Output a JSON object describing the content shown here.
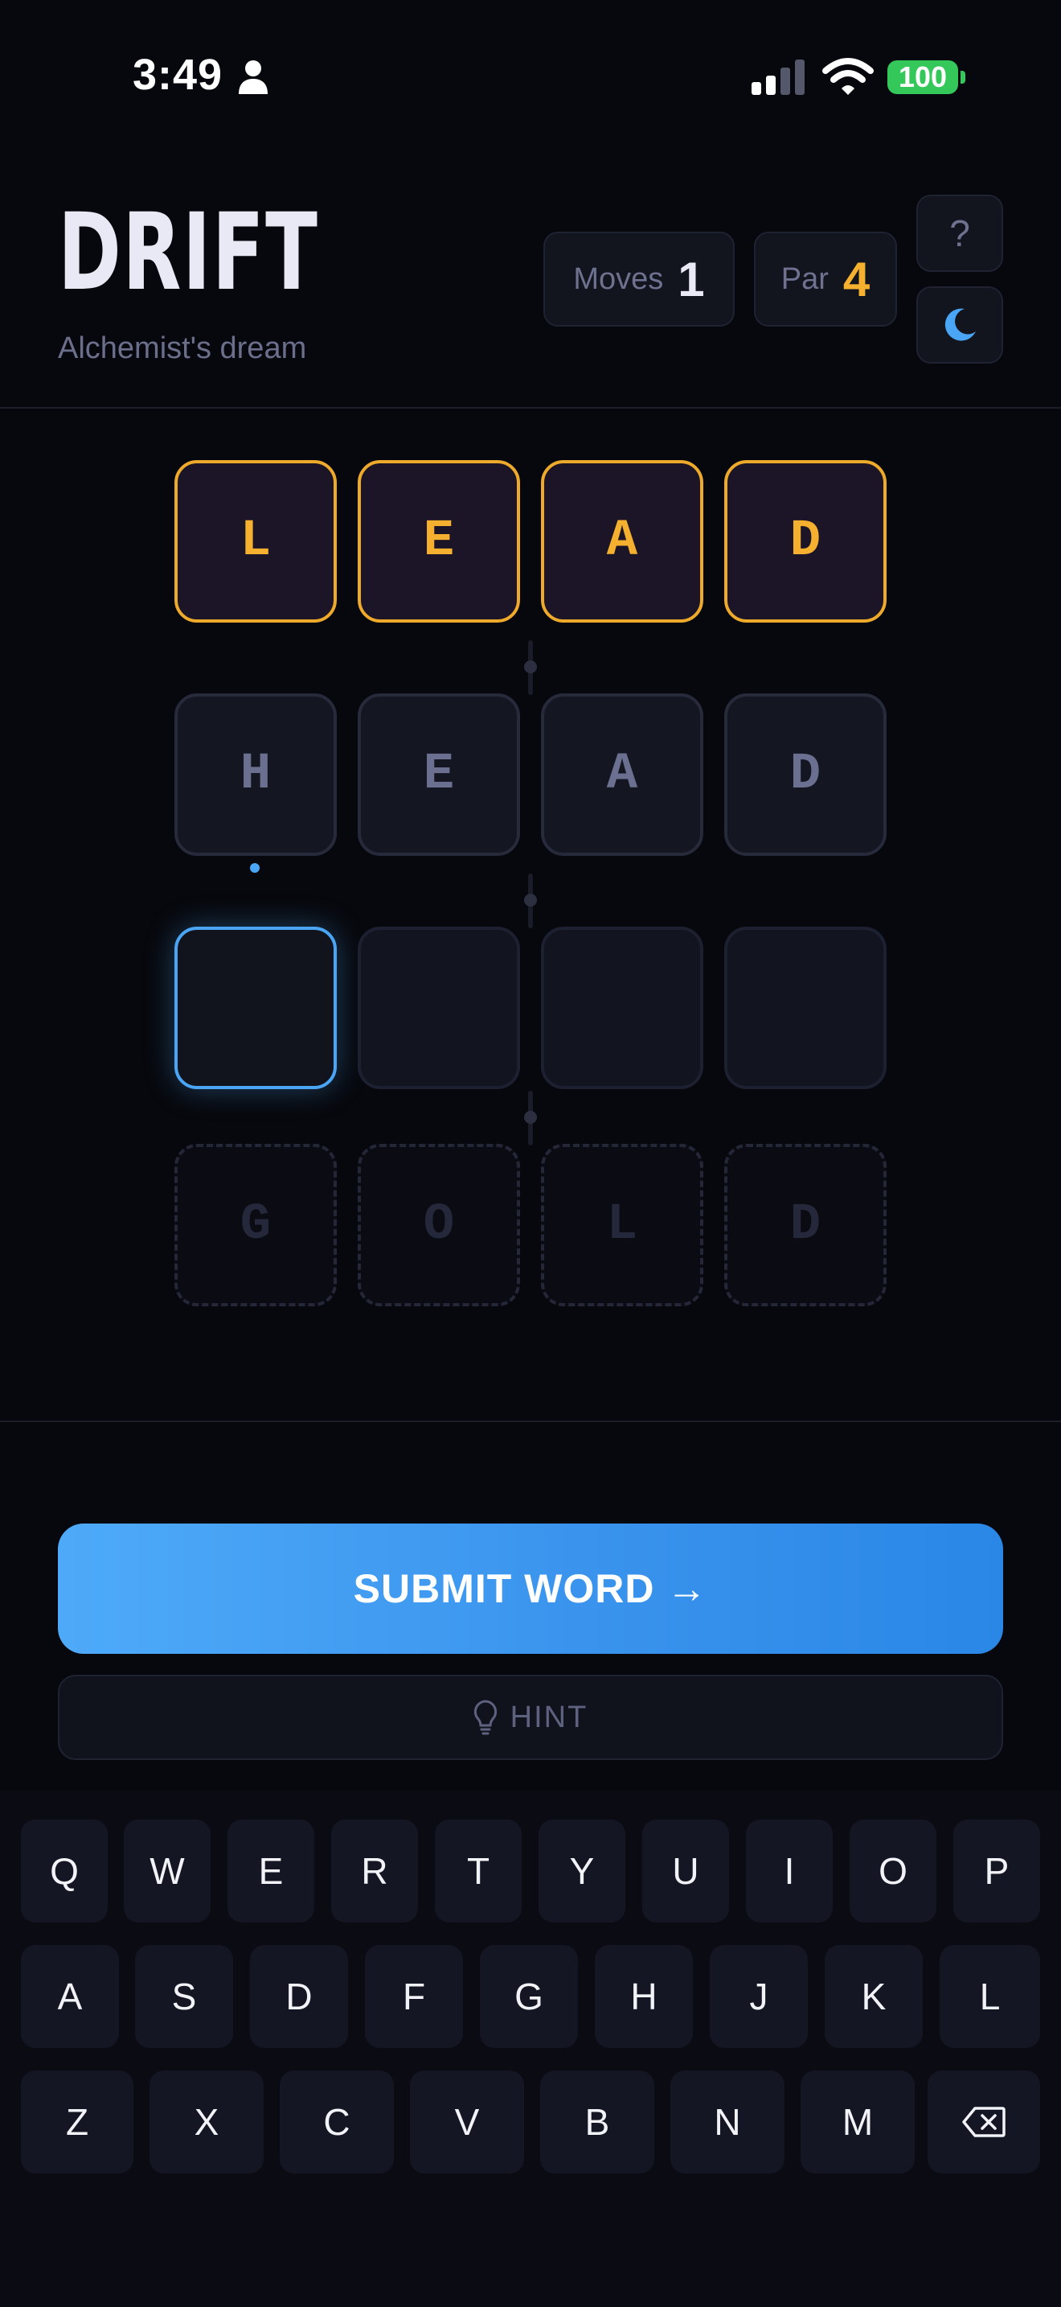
{
  "status_bar": {
    "time": "3:49",
    "battery": "100"
  },
  "header": {
    "title": "DRIFT",
    "subtitle": "Alchemist's dream",
    "moves_label": "Moves",
    "moves_value": "1",
    "par_label": "Par",
    "par_value": "4",
    "help_label": "?"
  },
  "board": {
    "start_word": [
      "L",
      "E",
      "A",
      "D"
    ],
    "played_words": [
      [
        "H",
        "E",
        "A",
        "D"
      ]
    ],
    "current_input": [
      "",
      "",
      "",
      ""
    ],
    "target_word": [
      "G",
      "O",
      "L",
      "D"
    ]
  },
  "actions": {
    "submit_label": "SUBMIT WORD →",
    "hint_label": "HINT"
  },
  "keyboard": {
    "row1": [
      "Q",
      "W",
      "E",
      "R",
      "T",
      "Y",
      "U",
      "I",
      "O",
      "P"
    ],
    "row2": [
      "A",
      "S",
      "D",
      "F",
      "G",
      "H",
      "J",
      "K",
      "L"
    ],
    "row3": [
      "Z",
      "X",
      "C",
      "V",
      "B",
      "N",
      "M"
    ]
  },
  "icons": {
    "status": [
      "person-icon",
      "signal-icon",
      "wifi-icon",
      "battery-icon"
    ],
    "header": [
      "help-icon",
      "moon-icon"
    ],
    "actions": [
      "lightbulb-icon"
    ],
    "keyboard": [
      "backspace-icon"
    ]
  },
  "colors": {
    "accent_blue": "#4aa6f5",
    "start_gold": "#f4b02e",
    "battery_green": "#34c759",
    "background": "#07080d"
  }
}
